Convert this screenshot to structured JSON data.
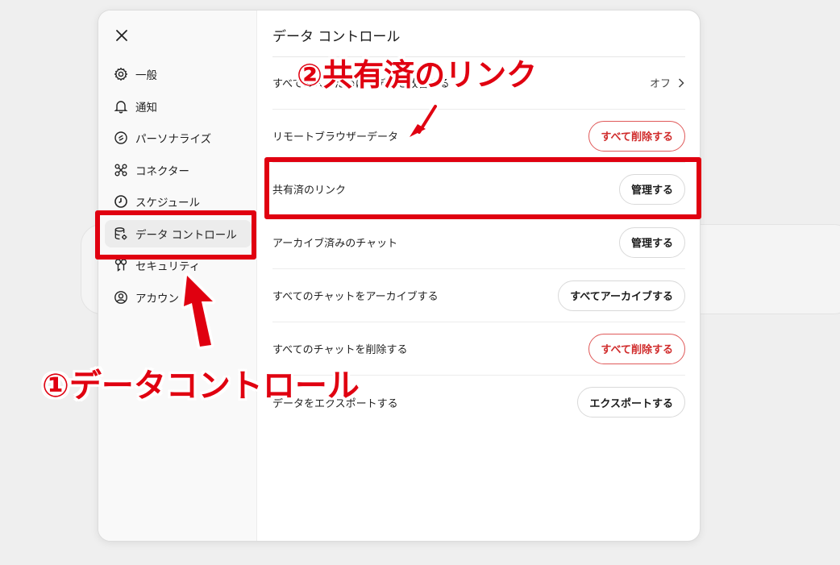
{
  "settings": {
    "nav": [
      {
        "label": "一般",
        "icon": "gear-icon"
      },
      {
        "label": "通知",
        "icon": "bell-icon"
      },
      {
        "label": "パーソナライズ",
        "icon": "personalize-icon"
      },
      {
        "label": "コネクター",
        "icon": "connector-icon"
      },
      {
        "label": "スケジュール",
        "icon": "clock-icon"
      },
      {
        "label": "データ コントロール",
        "icon": "database-gear-icon",
        "active": true
      },
      {
        "label": "セキュリティ",
        "icon": "security-icon"
      },
      {
        "label": "アカウント",
        "icon": "account-icon"
      }
    ],
    "title": "データ コントロール",
    "rows": [
      {
        "label": "すべての人のためにモデルを改善する",
        "value": "オフ"
      },
      {
        "label": "リモートブラウザーデータ",
        "button": "すべて削除する",
        "danger": true
      },
      {
        "label": "共有済のリンク",
        "button": "管理する"
      },
      {
        "label": "アーカイブ済みのチャット",
        "button": "管理する"
      },
      {
        "label": "すべてのチャットをアーカイブする",
        "button": "すべてアーカイブする"
      },
      {
        "label": "すべてのチャットを削除する",
        "button": "すべて削除する",
        "danger": true
      },
      {
        "label": "データをエクスポートする",
        "button": "エクスポートする"
      }
    ]
  },
  "annotations": {
    "step1": "①データコントロール",
    "step2": "②共有済のリンク",
    "color": "#e00010"
  }
}
